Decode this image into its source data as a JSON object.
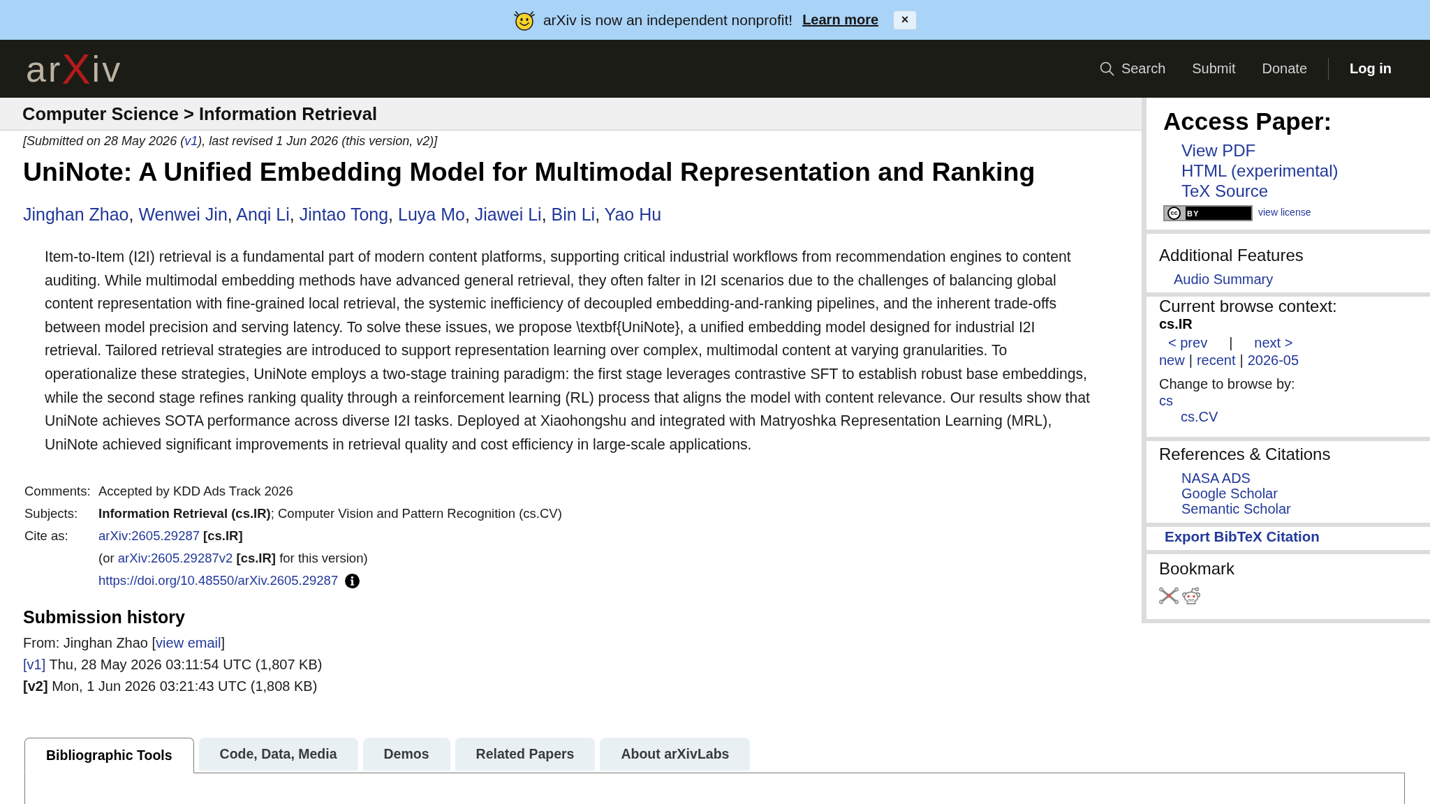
{
  "banner": {
    "message": "arXiv is now an independent nonprofit!",
    "link": "Learn more",
    "close": "×"
  },
  "header": {
    "logo": {
      "start": "ar",
      "mark": "X",
      "end": "iv"
    },
    "nav": [
      {
        "kind": "search",
        "label": "Search"
      },
      {
        "kind": "link",
        "label": "Submit"
      },
      {
        "kind": "link",
        "label": "Donate"
      },
      {
        "kind": "account",
        "label": "Log in"
      }
    ]
  },
  "breadcrumb": "Computer Science > Information Retrieval",
  "dateline": {
    "before": "[Submitted on 28 May 2026 (",
    "link": "v1",
    "after": "), last revised 1 Jun 2026 (this version, v2)]"
  },
  "title": "UniNote: A Unified Embedding Model for Multimodal Representation and Ranking",
  "authors": [
    {
      "name": "Jinghan Zhao",
      "separator": ","
    },
    {
      "name": "Wenwei Jin",
      "separator": ","
    },
    {
      "name": "Anqi Li",
      "separator": ","
    },
    {
      "name": "Jintao Tong",
      "separator": ","
    },
    {
      "name": "Luya Mo",
      "separator": ","
    },
    {
      "name": "Jiawei Li",
      "separator": ","
    },
    {
      "name": "Bin Li",
      "separator": ","
    },
    {
      "name": "Yao Hu"
    }
  ],
  "abstract": "Item-to-Item (I2I) retrieval is a fundamental part of modern content platforms, supporting critical industrial workflows from recommendation engines to content auditing. While multimodal embedding methods have advanced general retrieval, they often falter in I2I scenarios due to the challenges of balancing global content representation with fine-grained local retrieval, the systemic inefficiency of decoupled embedding-and-ranking pipelines, and the inherent trade-offs between model precision and serving latency. To solve these issues, we propose \\textbf{UniNote}, a unified embedding model designed for industrial I2I retrieval. Tailored retrieval strategies are introduced to support representation learning over complex, multimodal content at varying granularities. To operationalize these strategies, UniNote employs a two-stage training paradigm: the first stage leverages contrastive SFT to establish robust base embeddings, while the second stage refines ranking quality through a reinforcement learning (RL) process that aligns the model with content relevance. Our results show that UniNote achieves SOTA performance across diverse I2I tasks. Deployed at Xiaohongshu and integrated with Matryoshka Representation Learning (MRL), UniNote achieved significant improvements in retrieval quality and cost efficiency in large-scale applications.",
  "metadata": [
    {
      "kind": "text",
      "label": "Comments:",
      "value": "Accepted by KDD Ads Track 2026"
    },
    {
      "kind": "rich",
      "label": "Subjects:",
      "value": "**Information Retrieval (cs.IR)**; Computer Vision and Pattern Recognition (cs.CV)"
    },
    {
      "kind": "cite",
      "label": "Cite as:",
      "id": "arXiv:2605.29287",
      "category": "[cs.IR]",
      "version_note": {
        "before": "(or ",
        "link": "arXiv:2605.29287v2",
        "after": " **[cs.IR]** for this version)"
      },
      "doi": "https://doi.org/10.48550/arXiv.2605.29287"
    }
  ],
  "submission_history": {
    "heading": "Submission history",
    "from": {
      "before": "From: Jinghan Zhao [",
      "link": "view email",
      "after": "]"
    },
    "versions": [
      {
        "version": "[v1]",
        "current": false,
        "details": " Thu, 28 May 2026 03:11:54 UTC (1,807 KB)"
      },
      {
        "version": "[v2]",
        "current": true,
        "details": " Mon, 1 Jun 2026 03:21:43 UTC (1,808 KB)"
      }
    ]
  },
  "tabs": [
    {
      "label": "Bibliographic Tools",
      "selected": true
    },
    {
      "label": "Code, Data, Media",
      "selected": false
    },
    {
      "label": "Demos",
      "selected": false
    },
    {
      "label": "Related Papers",
      "selected": false
    },
    {
      "label": "About arXivLabs",
      "selected": false
    }
  ],
  "sidebar": {
    "access_paper": {
      "heading": "Access Paper:",
      "links": [
        "View PDF",
        "HTML (experimental)",
        "TeX Source"
      ],
      "license": {
        "badge_mark": "cc",
        "badge_label": "BY",
        "link": "view license"
      }
    },
    "additional_features": {
      "heading": "Additional Features",
      "links": [
        "Audio Summary"
      ]
    },
    "browse_context": {
      "heading": "Current browse context:",
      "context": "cs.IR",
      "pager": [
        {
          "kind": "link",
          "text": "< prev"
        },
        {
          "kind": "separator",
          "text": "|"
        },
        {
          "kind": "link",
          "text": "next >"
        }
      ],
      "listings": [
        {
          "kind": "link",
          "text": "new"
        },
        {
          "kind": "separator",
          "text": "|"
        },
        {
          "kind": "link",
          "text": "recent"
        },
        {
          "kind": "separator",
          "text": "|"
        },
        {
          "kind": "link",
          "text": "2026-05"
        }
      ],
      "change_label": "Change to browse by:",
      "categories": [
        {
          "label": "cs",
          "children": [
            {
              "label": "cs.CV"
            }
          ]
        }
      ]
    },
    "references": {
      "heading": "References & Citations",
      "links": [
        "NASA ADS",
        "Google Scholar",
        "Semantic Scholar"
      ]
    },
    "export": {
      "link": "Export BibTeX Citation"
    },
    "bookmark": {
      "heading": "Bookmark"
    }
  }
}
